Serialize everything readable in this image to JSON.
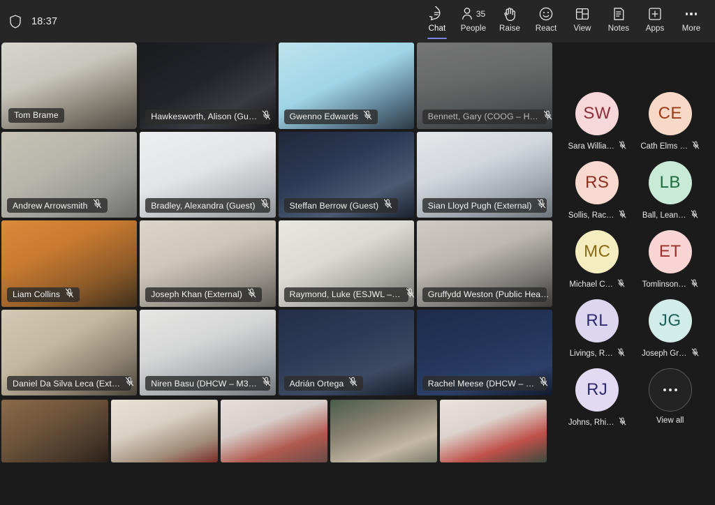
{
  "topbar": {
    "shield_icon": "shield-icon",
    "time": "18:37",
    "actions": [
      {
        "icon": "chat-icon",
        "label": "Chat",
        "active": true
      },
      {
        "icon": "people-icon",
        "label": "People",
        "count": "35",
        "active": false
      },
      {
        "icon": "raise-hand-icon",
        "label": "Raise",
        "active": false
      },
      {
        "icon": "react-smiley-icon",
        "label": "React",
        "active": false
      },
      {
        "icon": "view-layout-icon",
        "label": "View",
        "active": false
      },
      {
        "icon": "notes-icon",
        "label": "Notes",
        "active": false
      },
      {
        "icon": "apps-plus-icon",
        "label": "Apps",
        "active": false
      },
      {
        "icon": "more-ellipsis-icon",
        "label": "More",
        "active": false
      }
    ]
  },
  "stage": {
    "tiles": [
      {
        "name": "Tom Brame",
        "muted": false,
        "speaking": true,
        "dim": false,
        "bg": "linear-gradient(160deg,#d8d5cd 0%,#c9c6bd 38%,#8a8478 70%,#4d4a42 100%)"
      },
      {
        "name": "Hawkesworth, Alison (Gu…",
        "muted": true,
        "speaking": false,
        "dim": false,
        "bg": "linear-gradient(150deg,#1a1b1f 0%,#23242a 45%,#3a3b42 72%,#151519 100%)"
      },
      {
        "name": "Gwenno Edwards",
        "muted": true,
        "speaking": false,
        "dim": false,
        "bg": "linear-gradient(155deg,#bfe3ee 0%,#9fd5e6 45%,#5f7f93 75%,#2b3a46 100%)"
      },
      {
        "name": "Bennett, Gary (COOG – H…",
        "muted": true,
        "speaking": false,
        "dim": true,
        "bg": "linear-gradient(170deg,#c9cbc9 0%,#b4b7b6 40%,#8e9294 70%,#5d6163 100%)"
      },
      {
        "name": "Andrew Arrowsmith",
        "muted": true,
        "speaking": false,
        "dim": false,
        "bg": "linear-gradient(150deg,#c6c2b6 0%,#b8b5ab 40%,#9a9b97 70%,#6e6f6c 100%)"
      },
      {
        "name": "Bradley, Alexandra (Guest)",
        "muted": true,
        "speaking": false,
        "dim": false,
        "bg": "linear-gradient(160deg,#eceef0 0%,#e2e4e7 45%,#b9bcc0 75%,#8e9297 100%)"
      },
      {
        "name": "Steffan Berrow (Guest)",
        "muted": true,
        "speaking": false,
        "dim": false,
        "bg": "linear-gradient(155deg,#20283c 0%,#2c3a55 40%,#4b5a72 72%,#1b2230 100%)"
      },
      {
        "name": "Sian Lloyd Pugh (External)",
        "muted": true,
        "speaking": false,
        "dim": false,
        "bg": "linear-gradient(160deg,#e4e7ea 0%,#d2d7dc 40%,#9fa7b0 72%,#6d747c 100%)"
      },
      {
        "name": "Liam Collins",
        "muted": true,
        "speaking": false,
        "dim": false,
        "bg": "linear-gradient(155deg,#d98a3c 0%,#c97a30 35%,#8c5a28 70%,#40301c 100%)"
      },
      {
        "name": "Joseph Khan (External)",
        "muted": true,
        "speaking": false,
        "dim": false,
        "bg": "linear-gradient(160deg,#dcd5cb 0%,#cdc6bb 40%,#9a958c 72%,#5e5b55 100%)"
      },
      {
        "name": "Raymond, Luke (ESJWL –…",
        "muted": true,
        "speaking": false,
        "dim": false,
        "bg": "linear-gradient(155deg,#e9e7e2 0%,#dbd9d3 42%,#a8a8a2 72%,#6d6e6b 100%)"
      },
      {
        "name": "Gruffydd Weston (Public Hea…",
        "muted": false,
        "speaking": false,
        "dim": false,
        "bg": "linear-gradient(160deg,#cfcac2 0%,#bdb8b0 40%,#7c7a77 72%,#3c3b3a 100%)"
      },
      {
        "name": "Daniel Da Silva Leca (Ext…",
        "muted": true,
        "speaking": false,
        "dim": false,
        "bg": "linear-gradient(150deg,#d5c8b4 0%,#c4b79f 40%,#8d8270 72%,#4a453b 100%)"
      },
      {
        "name": "Niren Basu (DHCW – M3…",
        "muted": true,
        "speaking": false,
        "dim": false,
        "bg": "linear-gradient(160deg,#e6e6e4 0%,#d5d6d6 40%,#a6abaf 72%,#70767b 100%)"
      },
      {
        "name": "Adrián Ortega",
        "muted": true,
        "speaking": false,
        "dim": false,
        "bg": "linear-gradient(160deg,#243049 0%,#2c3a55 40%,#3d4a63 72%,#161d2b 100%)"
      },
      {
        "name": "Rachel Meese (DHCW – …",
        "muted": true,
        "speaking": false,
        "dim": false,
        "bg": "linear-gradient(165deg,#1d2c4a 0%,#23355a 45%,#2b3f68 75%,#121a2c 100%)"
      }
    ],
    "strip": [
      {
        "bg": "linear-gradient(150deg,#8a6a4a 0%,#6e543c 40%,#4a392a 75%,#2a2019 100%)"
      },
      {
        "bg": "linear-gradient(160deg,#e8e2d6 0%,#d9d2c4 40%,#a08a76 75%,#7a2a28 100%)"
      },
      {
        "bg": "linear-gradient(160deg,#e6dedb 0%,#d8cfcb 38%,#b05a50 70%,#6a4a46 100%)"
      },
      {
        "bg": "linear-gradient(160deg,#4a5c4a 0%,#8a8272 40%,#c3b9a4 72%,#7c7a6a 100%)"
      },
      {
        "bg": "linear-gradient(160deg,#e9e3dc 0%,#dcd4cd 38%,#c0504a 70%,#3b4a3e 100%)"
      },
      {
        "bg": "linear-gradient(155deg,#9a8e80 0%,#c4b9a8 35%,#8a7d6e 70%,#4e453c 100%)"
      }
    ]
  },
  "roster": {
    "participants": [
      {
        "initials": "SW",
        "name": "Sara Willia…",
        "muted": true,
        "bg": "#f6d7da",
        "fg": "#8c2f38"
      },
      {
        "initials": "CE",
        "name": "Cath Elms …",
        "muted": true,
        "bg": "#f8d9c8",
        "fg": "#9c3a18"
      },
      {
        "initials": "RS",
        "name": "Sollis, Rac…",
        "muted": true,
        "bg": "#f7d9cf",
        "fg": "#8c2f22"
      },
      {
        "initials": "LB",
        "name": "Ball, Lean…",
        "muted": true,
        "bg": "#c8ead6",
        "fg": "#1d6b3f"
      },
      {
        "initials": "MC",
        "name": "Michael C…",
        "muted": true,
        "bg": "#f4edc0",
        "fg": "#8a6a12"
      },
      {
        "initials": "ET",
        "name": "Tomlinson…",
        "muted": true,
        "bg": "#f8d5d4",
        "fg": "#9c2f2a"
      },
      {
        "initials": "RL",
        "name": "Livings, R…",
        "muted": true,
        "bg": "#ddd6f0",
        "fg": "#2e2a6e"
      },
      {
        "initials": "JG",
        "name": "Joseph Gr…",
        "muted": true,
        "bg": "#d2ece9",
        "fg": "#1d6059"
      },
      {
        "initials": "RJ",
        "name": "Johns, Rhi…",
        "muted": true,
        "bg": "#e2daf2",
        "fg": "#2e2a6e"
      }
    ],
    "view_all": {
      "icon": "more-ellipsis-icon",
      "label": "View all"
    }
  },
  "colors": {
    "accent": "#7b83eb",
    "topbar_bg": "#262626",
    "stage_bg": "#1b1b1b"
  }
}
